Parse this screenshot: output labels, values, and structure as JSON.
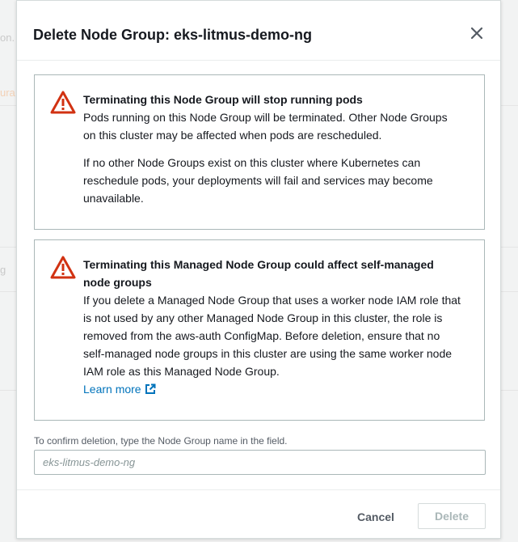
{
  "background": {
    "fragments": [
      "on.",
      "ura",
      "g"
    ]
  },
  "modal": {
    "title": "Delete Node Group: eks-litmus-demo-ng",
    "close_icon": "close-icon"
  },
  "alerts": [
    {
      "icon": "warning-icon",
      "title": "Terminating this Node Group will stop running pods",
      "paragraphs": [
        "Pods running on this Node Group will be terminated. Other Node Groups on this cluster may be affected when pods are rescheduled.",
        "If no other Node Groups exist on this cluster where Kubernetes can reschedule pods, your deployments will fail and services may become unavailable."
      ]
    },
    {
      "icon": "warning-icon",
      "title": "Terminating this Managed Node Group could affect self-managed node groups",
      "paragraphs": [
        "If you delete a Managed Node Group that uses a worker node IAM role that is not used by any other Managed Node Group in this cluster, the role is removed from the aws-auth ConfigMap. Before deletion, ensure that no self-managed node groups in this cluster are using the same worker node IAM role as this Managed Node Group."
      ],
      "link_label": "Learn more",
      "link_icon": "external-link-icon"
    }
  ],
  "confirm": {
    "label": "To confirm deletion, type the Node Group name in the field.",
    "placeholder": "eks-litmus-demo-ng",
    "value": ""
  },
  "footer": {
    "cancel_label": "Cancel",
    "delete_label": "Delete"
  },
  "colors": {
    "warning": "#d13212",
    "link": "#0073bb",
    "disabled": "#aab7b8"
  }
}
